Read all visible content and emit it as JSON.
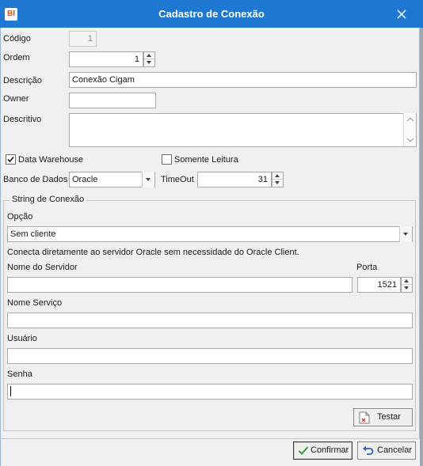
{
  "window": {
    "title": "Cadastro de Conexão",
    "app_icon_text": "BI"
  },
  "form": {
    "codigo": {
      "label": "Código",
      "value": "1"
    },
    "ordem": {
      "label": "Ordem",
      "value": "1"
    },
    "descricao": {
      "label": "Descrição",
      "value": "Conexão Cigam"
    },
    "owner": {
      "label": "Owner",
      "value": ""
    },
    "descritivo": {
      "label": "Descritivo",
      "value": ""
    },
    "data_warehouse": {
      "label": "Data Warehouse",
      "checked": true
    },
    "somente_leitura": {
      "label": "Somente Leitura",
      "checked": false
    },
    "banco_dados": {
      "label": "Banco de Dados",
      "value": "Oracle"
    },
    "timeout": {
      "label": "TimeOut",
      "value": "31"
    }
  },
  "connection": {
    "group_title": "String de Conexão",
    "opcao": {
      "label": "Opção",
      "value": "Sem cliente"
    },
    "info": "Conecta diretamente ao servidor Oracle sem necessidade do Oracle Client.",
    "servidor": {
      "label": "Nome do Servidor",
      "value": ""
    },
    "porta": {
      "label": "Porta",
      "value": "1521"
    },
    "servico": {
      "label": "Nome Serviço",
      "value": ""
    },
    "usuario": {
      "label": "Usuário",
      "value": ""
    },
    "senha": {
      "label": "Senha",
      "value": ""
    },
    "testar_label": "Testar"
  },
  "footer": {
    "confirm_label": "Confirmar",
    "cancel_label": "Cancelar"
  },
  "colors": {
    "titlebar": "#1f79d2",
    "confirm_icon": "#3a9a3a",
    "cancel_icon": "#2a66b8"
  }
}
